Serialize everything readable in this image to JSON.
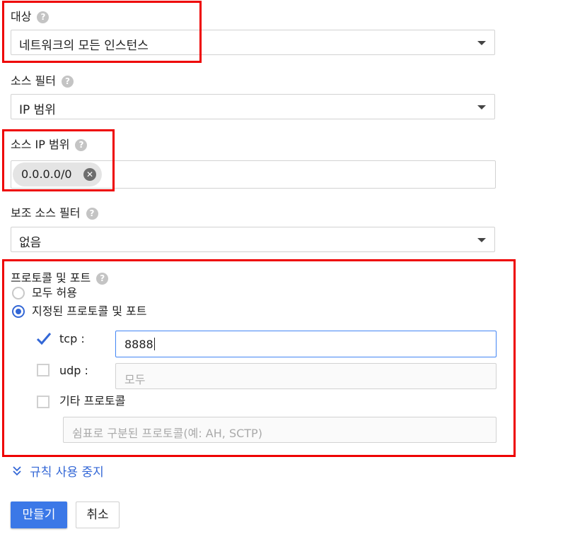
{
  "target": {
    "label": "대상",
    "value": "네트워크의 모든 인스턴스"
  },
  "source_filter": {
    "label": "소스 필터",
    "value": "IP 범위"
  },
  "source_ip_ranges": {
    "label": "소스 IP 범위",
    "chips": [
      "0.0.0.0/0"
    ]
  },
  "secondary_source_filter": {
    "label": "보조 소스 필터",
    "value": "없음"
  },
  "protocols_ports": {
    "label": "프로토콜 및 포트",
    "allow_all_label": "모두 허용",
    "specified_label": "지정된 프로토콜 및 포트",
    "selected": "specified",
    "tcp": {
      "label": "tcp :",
      "checked": true,
      "value": "8888"
    },
    "udp": {
      "label": "udp :",
      "checked": false,
      "placeholder": "모두"
    },
    "other": {
      "label": "기타 프로토콜",
      "checked": false,
      "placeholder": "쉼표로 구분된 프로토콜(예: AH, SCTP)"
    }
  },
  "disable_rule_link": "규칙 사용 중지",
  "buttons": {
    "create": "만들기",
    "cancel": "취소"
  },
  "help_glyph": "?",
  "colors": {
    "accent": "#3b78e7",
    "highlight": "#ee0000"
  }
}
